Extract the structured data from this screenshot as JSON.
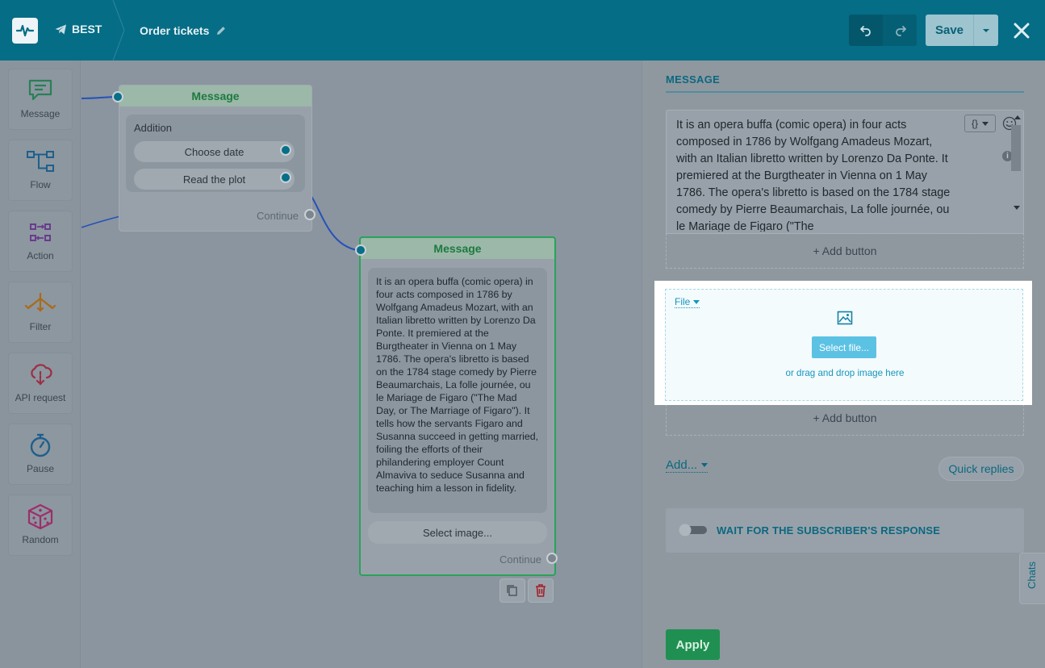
{
  "header": {
    "bot_name": "BEST",
    "flow_name": "Order tickets",
    "save_label": "Save"
  },
  "palette": {
    "items": [
      {
        "label": "Message",
        "icon": "message-icon"
      },
      {
        "label": "Flow",
        "icon": "flow-icon"
      },
      {
        "label": "Action",
        "icon": "action-icon"
      },
      {
        "label": "Filter",
        "icon": "filter-icon"
      },
      {
        "label": "API request",
        "icon": "api-request-icon"
      },
      {
        "label": "Pause",
        "icon": "pause-icon"
      },
      {
        "label": "Random",
        "icon": "random-icon"
      }
    ]
  },
  "canvas": {
    "node1": {
      "title": "Message",
      "block_title": "Addition",
      "buttons": [
        "Choose date",
        "Read the plot"
      ],
      "continue_label": "Continue"
    },
    "node2": {
      "title": "Message",
      "text": "It is an opera buffa (comic opera) in four acts composed in 1786 by Wolfgang Amadeus Mozart, with an Italian libretto written by Lorenzo Da Ponte. It premiered at the Burgtheater in Vienna on 1 May 1786. The opera's libretto is based on the 1784 stage comedy by Pierre Beaumarchais, La folle journée, ou le Mariage de Figaro (\"The Mad Day, or The Marriage of Figaro\"). It tells how the servants Figaro and Susanna succeed in getting married, foiling the efforts of their philandering employer Count Almaviva to seduce Susanna and teaching him a lesson in fidelity.",
      "select_image_label": "Select image...",
      "continue_label": "Continue"
    }
  },
  "panel": {
    "title": "MESSAGE",
    "message_text": "It is an opera buffa (comic opera) in four acts composed in 1786 by Wolfgang Amadeus Mozart, with an Italian libretto written by Lorenzo Da Ponte. It premiered at the Burgtheater in Vienna on 1 May 1786. The opera's libretto is based on the 1784 stage comedy by Pierre Beaumarchais, La folle journée, ou le Mariage de Figaro (\"The",
    "variable_btn_label": "{}",
    "add_button_label": "+ Add button",
    "file": {
      "type_label": "File",
      "select_file_label": "Select file...",
      "drag_text": "or drag and drop image here"
    },
    "add_button_label_2": "+ Add button",
    "add_label": "Add...",
    "quick_replies_label": "Quick replies",
    "wait_label": "WAIT FOR THE SUBSCRIBER'S RESPONSE",
    "chats_label": "Chats",
    "apply_label": "Apply"
  }
}
